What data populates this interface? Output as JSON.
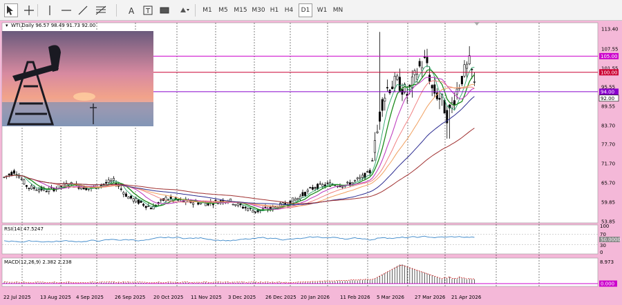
{
  "toolbar": {
    "tools": [
      {
        "name": "cursor-tool",
        "icon": "arrow-cursor-icon"
      },
      {
        "name": "crosshair-tool",
        "icon": "crosshair-icon"
      },
      {
        "name": "vertical-line-tool",
        "icon": "vertical-line-icon"
      },
      {
        "name": "horizontal-line-tool",
        "icon": "horizontal-line-icon"
      },
      {
        "name": "trendline-tool",
        "icon": "trendline-icon"
      },
      {
        "name": "fibonacci-tool",
        "icon": "fibonacci-icon"
      },
      {
        "name": "text-tool",
        "icon": "text-A-icon",
        "glyph": "A"
      },
      {
        "name": "text-label-tool",
        "icon": "text-label-icon",
        "glyph": "T"
      },
      {
        "name": "rectangle-tool",
        "icon": "rectangle-icon"
      },
      {
        "name": "shapes-tool",
        "icon": "shapes-dropdown-icon"
      }
    ],
    "timeframes": [
      "M1",
      "M5",
      "M15",
      "M30",
      "H1",
      "H4",
      "D1",
      "W1",
      "MN"
    ],
    "active_timeframe": "D1"
  },
  "chart": {
    "header": "WTI,Daily  96.57 98.49 91.73 92.00",
    "indicator_rsi": "RSI(14) 47.5247",
    "indicator_macd": "MACD(12,26,9) 2.382 2.238",
    "price_axis": [
      "113.40",
      "107.55",
      "101.55",
      "95.55",
      "89.55",
      "83.70",
      "77.70",
      "71.70",
      "65.70",
      "59.85",
      "53.85"
    ],
    "price_labels": [
      {
        "text": "105.00",
        "value": 105.0,
        "color": "#cc00cc"
      },
      {
        "text": "100.00",
        "value": 100.0,
        "color": "#cc0033"
      },
      {
        "text": "94.00",
        "value": 94.0,
        "color": "#8800cc"
      },
      {
        "text": "92.00",
        "value": 92.0,
        "color": "#000000"
      }
    ],
    "rsi_axis": [
      "100",
      "70",
      "30",
      "0"
    ],
    "rsi_current_label": "50.0000",
    "macd_axis_top": "8.973",
    "macd_current_label": "0.000",
    "date_axis": [
      "22 Jul 2025",
      "13 Aug 2025",
      "4 Sep 2025",
      "26 Sep 2025",
      "20 Oct 2025",
      "11 Nov 2025",
      "3 Dec 2025",
      "26 Dec 2025",
      "20 Jan 2026",
      "11 Feb 2026",
      "5 Mar 2026",
      "27 Mar 2026",
      "21 Apr 2026"
    ]
  },
  "colors": {
    "background": "#f4b8d8",
    "plot_bg": "#ffffff",
    "candles": "#000000",
    "line_105": "#cc00cc",
    "line_100": "#cc0033",
    "line_94": "#8800cc",
    "ma_fast": "#2aa56a",
    "ma_green": "#1a8a1a",
    "ma_magenta": "#c040c0",
    "ma_salmon": "#f08080",
    "ma_orange": "#f0a060",
    "ma_navy": "#2a2a90",
    "ma_brown": "#a03030",
    "rsi_line": "#3a86c8"
  }
}
